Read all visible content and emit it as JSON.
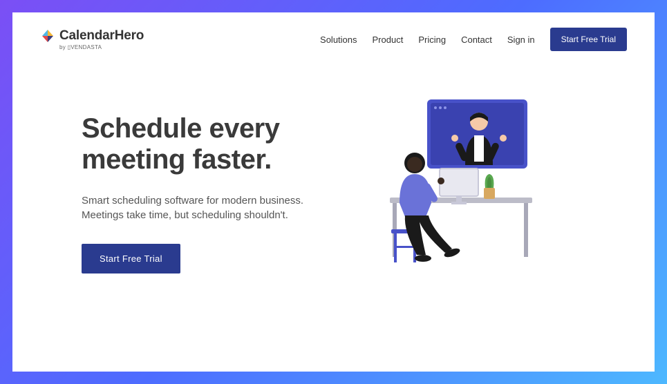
{
  "brand": {
    "name": "CalendarHero",
    "byline": "by ▯VENDASTA"
  },
  "nav": {
    "items": [
      "Solutions",
      "Product",
      "Pricing",
      "Contact",
      "Sign in"
    ],
    "cta": "Start Free Trial"
  },
  "hero": {
    "title": "Schedule every meeting faster.",
    "subtitle": "Smart scheduling software for modern business. Meetings take time, but scheduling shouldn't.",
    "cta": "Start Free Trial"
  },
  "colors": {
    "primary": "#2a3b8f"
  }
}
